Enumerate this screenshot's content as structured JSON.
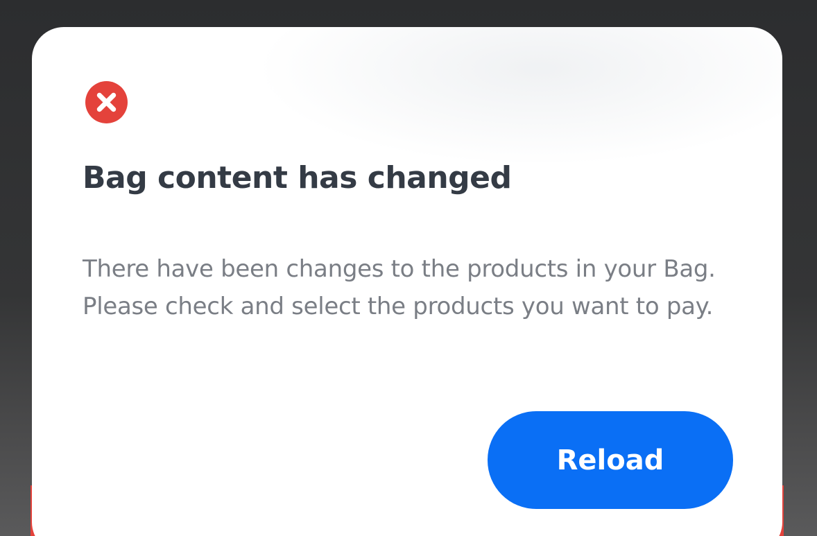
{
  "dialog": {
    "icon": "error-x-circle-icon",
    "title": "Bag content has changed",
    "message": "There have been changes to the products in your Bag. Please check and select the products you want to pay.",
    "reload_label": "Reload"
  },
  "colors": {
    "error_red": "#e4423b",
    "button_blue": "#0a6ff5",
    "title_text": "#343b45",
    "body_text": "#7a7e85",
    "overlay": "#2c2d2f"
  }
}
